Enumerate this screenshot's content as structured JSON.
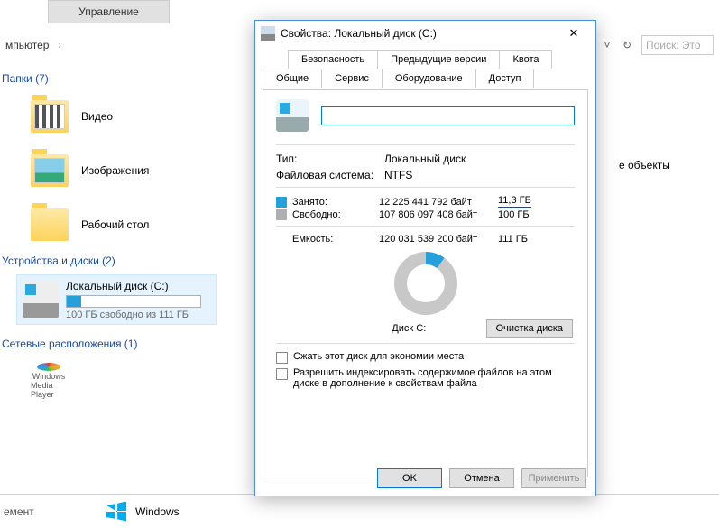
{
  "ribbon": {
    "manage": "Управление"
  },
  "addressbar": {
    "computer": "мпьютер",
    "refresh_aria": "Обновить",
    "dropdown_aria": "История"
  },
  "search": {
    "placeholder": "Поиск: Это"
  },
  "explorer": {
    "folders_header": "Папки (7)",
    "items": [
      {
        "label": "Видео",
        "kind": "vid"
      },
      {
        "label": "Изображения",
        "kind": "img"
      },
      {
        "label": "Рабочий стол",
        "kind": "desk"
      }
    ],
    "devices_header": "Устройства и диски (2)",
    "disk": {
      "name": "Локальный диск (C:)",
      "free_text": "100 ГБ свободно из 111 ГБ"
    },
    "network_header": "Сетевые расположения (1)",
    "wmp": {
      "line1": "Windows",
      "line2": "Media Player"
    }
  },
  "side_text": "е объекты",
  "bottom": {
    "element": "емент",
    "windows": "Windows"
  },
  "dialog": {
    "title": "Свойства: Локальный диск (C:)",
    "tabs_top": [
      "Безопасность",
      "Предыдущие версии",
      "Квота"
    ],
    "tabs_bottom": [
      "Общие",
      "Сервис",
      "Оборудование",
      "Доступ"
    ],
    "name_value": "",
    "type_label": "Тип:",
    "type_value": "Локальный диск",
    "fs_label": "Файловая система:",
    "fs_value": "NTFS",
    "used_label": "Занято:",
    "used_bytes": "12 225 441 792 байт",
    "used_h": "11,3 ГБ",
    "free_label": "Свободно:",
    "free_bytes": "107 806 097 408 байт",
    "free_h": "100 ГБ",
    "cap_label": "Емкость:",
    "cap_bytes": "120 031 539 200 байт",
    "cap_h": "111 ГБ",
    "donut_label": "Диск C:",
    "cleanup": "Очистка диска",
    "compress": "Сжать этот диск для экономии места",
    "index": "Разрешить индексировать содержимое файлов на этом диске в дополнение к свойствам файла",
    "ok": "OK",
    "cancel": "Отмена",
    "apply": "Применить"
  },
  "chart_data": {
    "type": "pie",
    "title": "Диск C:",
    "categories": [
      "Занято",
      "Свободно"
    ],
    "values": [
      12225441792,
      107806097408
    ],
    "series": [
      {
        "name": "Занято",
        "bytes": 12225441792,
        "human": "11,3 ГБ",
        "color": "#26a0da"
      },
      {
        "name": "Свободно",
        "bytes": 107806097408,
        "human": "100 ГБ",
        "color": "#c8c8c8"
      }
    ],
    "total": {
      "label": "Емкость",
      "bytes": 120031539200,
      "human": "111 ГБ"
    }
  }
}
